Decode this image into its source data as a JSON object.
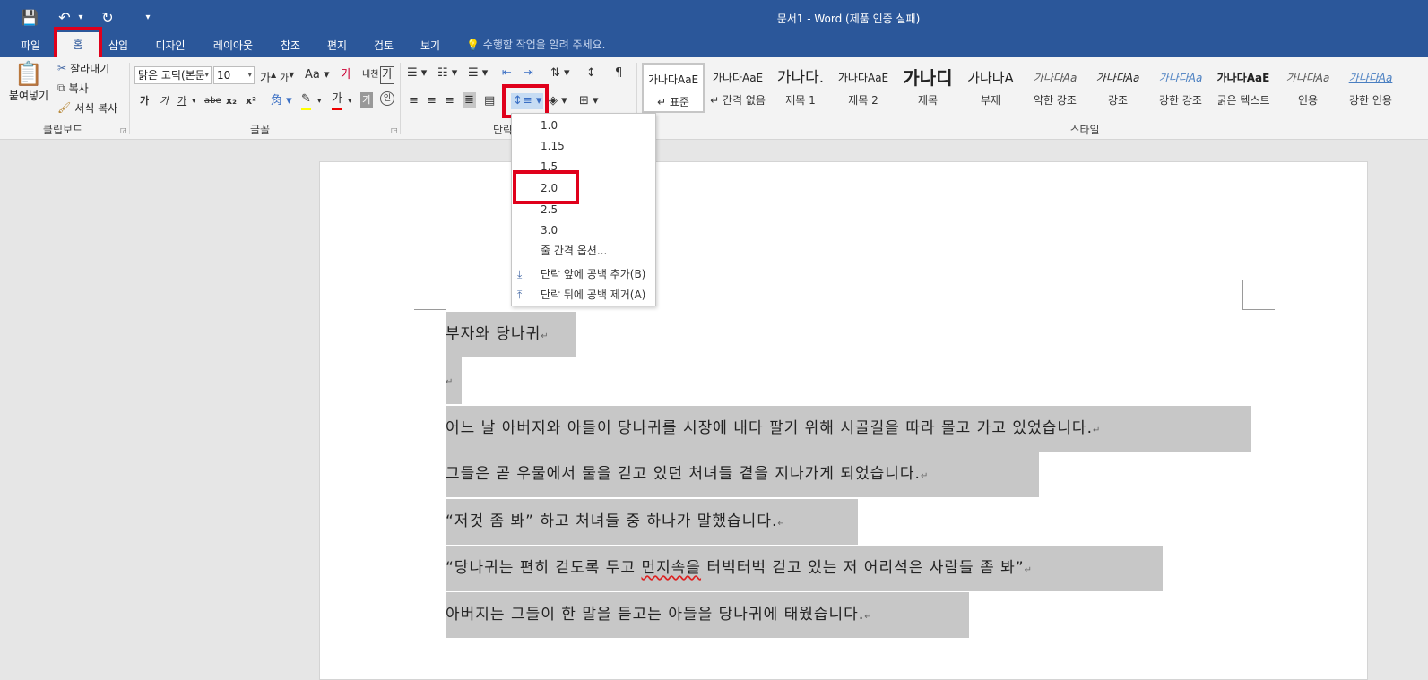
{
  "window": {
    "title": "문서1 - Word (제품 인증 실패)"
  },
  "qat": {
    "save": "💾",
    "undo": "↶",
    "undo_more": "▾",
    "redo": "↻",
    "customize": "▾"
  },
  "tabs": [
    {
      "label": "파일"
    },
    {
      "label": "홈"
    },
    {
      "label": "삽입"
    },
    {
      "label": "디자인"
    },
    {
      "label": "레이아웃"
    },
    {
      "label": "참조"
    },
    {
      "label": "편지"
    },
    {
      "label": "검토"
    },
    {
      "label": "보기"
    }
  ],
  "tell_me": "수행할 작업을 알려 주세요.",
  "clipboard": {
    "paste": "붙여넣기",
    "cut": "잘라내기",
    "copy": "복사",
    "format_painter": "서식 복사",
    "group": "클립보드"
  },
  "font": {
    "name": "맑은 고딕(본문",
    "size": "10",
    "group": "글꼴",
    "bold": "가",
    "italic": "가",
    "underline": "가",
    "strike": "abe",
    "sub": "x₂",
    "sup": "x²",
    "grow": "가",
    "shrink": "가",
    "case": "Aa",
    "clear": "가",
    "phonetic": "내천",
    "border": "가"
  },
  "paragraph": {
    "group": "단락"
  },
  "styles": {
    "group": "스타일",
    "items": [
      {
        "preview": "가나다AaE",
        "name": "↵ 표준"
      },
      {
        "preview": "가나다AaE",
        "name": "↵ 간격 없음"
      },
      {
        "preview": "가나다.",
        "name": "제목 1"
      },
      {
        "preview": "가나다AaE",
        "name": "제목 2"
      },
      {
        "preview": "가나디",
        "name": "제목"
      },
      {
        "preview": "가나다A",
        "name": "부제"
      },
      {
        "preview": "가나다Aa",
        "name": "약한 강조"
      },
      {
        "preview": "가나다Aa",
        "name": "강조"
      },
      {
        "preview": "가나다Aa",
        "name": "강한 강조"
      },
      {
        "preview": "가나다AaE",
        "name": "굵은 텍스트"
      },
      {
        "preview": "가나다Aa",
        "name": "인용"
      },
      {
        "preview": "가나다Aa",
        "name": "강한 인용"
      }
    ]
  },
  "line_spacing_menu": {
    "options": [
      "1.0",
      "1.15",
      "1.5",
      "2.0",
      "2.5",
      "3.0"
    ],
    "more": "줄 간격 옵션...",
    "add_before": "단락 앞에 공백 추가(B)",
    "remove_after": "단락 뒤에 공백 제거(A)"
  },
  "document": {
    "paragraphs": [
      "부자와 당나귀",
      "",
      "어느 날 아버지와 아들이 당나귀를 시장에 내다 팔기 위해 시골길을 따라 몰고 가고 있었습니다.",
      "그들은 곧 우물에서 물을 긷고 있던 처녀들 곁을 지나가게 되었습니다.",
      "“저것 좀 봐” 하고 처녀들 중 하나가 말했습니다.",
      "“당나귀는 편히 걷도록 두고 ",
      "아버지는 그들이 한 말을 듣고는 아들을 당나귀에 태웠습니다."
    ],
    "p6_squiggle": "먼지속을",
    "p6_rest": " 터벅터벅 걷고 있는 저 어리석은 사람들 좀 봐”",
    "mark": "↵"
  }
}
